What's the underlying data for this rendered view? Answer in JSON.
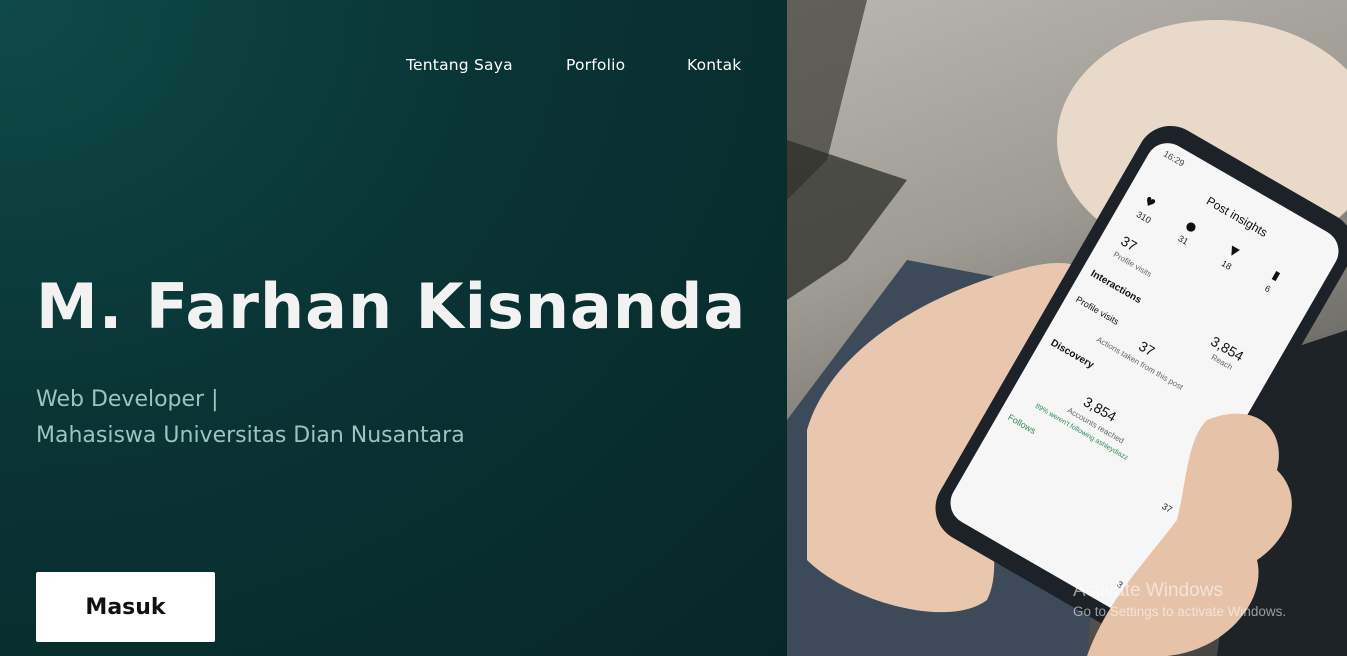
{
  "nav": {
    "items": [
      "Tentang Saya",
      "Porfolio",
      "Kontak"
    ]
  },
  "hero": {
    "name": "M. Farhan Kisnanda",
    "subtitle_line1": "Web Developer |",
    "subtitle_line2": "Mahasiswa Universitas Dian Nusantara",
    "button_label": "Masuk"
  },
  "phone": {
    "time": "16:29",
    "header": "Post insights",
    "likes": "310",
    "comments": "31",
    "shares": "18",
    "saves": "6",
    "profile_visits_value": "37",
    "profile_visits_label": "Profile visits",
    "interactions_label": "Interactions",
    "reach_value": "3,854",
    "reach_label": "Reach",
    "actions_value": "37",
    "actions_label": "Actions taken from this post",
    "profile_visits_row": "Profile visits",
    "discovery_label": "Discovery",
    "accounts_reached_value": "3,854",
    "accounts_reached_label": "Accounts reached",
    "accounts_reached_note": "89% weren't following ashleydiazz",
    "follows_label": "Follows",
    "follows_value": "37",
    "bottom_value": "3"
  },
  "watermark": {
    "line1": "Activate Windows",
    "line2": "Go to Settings to activate Windows."
  },
  "colors": {
    "left_panel": "#0a3434",
    "title": "#f2f2f2",
    "subtitle": "#9cc4be",
    "button_bg": "#ffffff"
  }
}
